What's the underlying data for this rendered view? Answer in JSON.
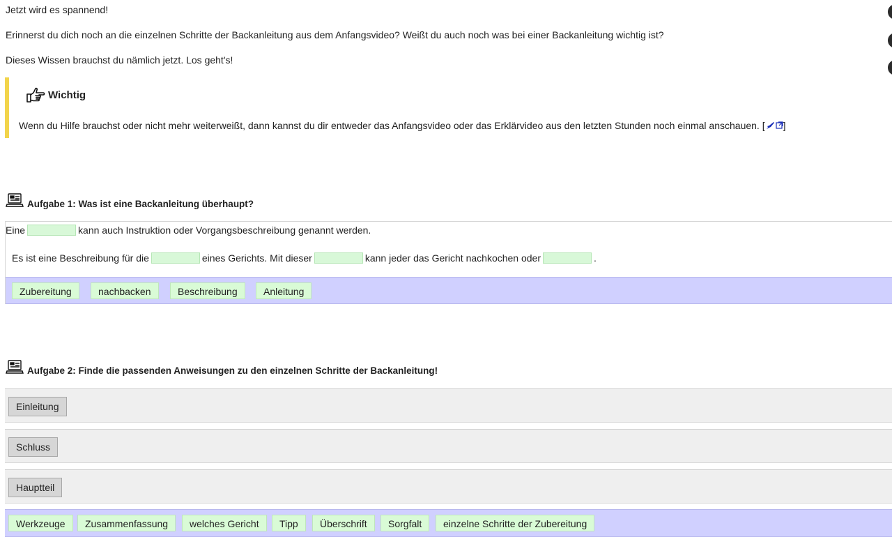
{
  "intro": {
    "line1": "Jetzt wird es spannend!",
    "line2": "Erinnerst du dich noch an die einzelnen Schritte der Backanleitung aus dem Anfangsvideo? Weißt du auch noch was bei einer Backanleitung wichtig ist?",
    "line3": "Dieses Wissen brauchst du nämlich jetzt. Los geht's!"
  },
  "notice": {
    "icon": "pointing-hand-icon",
    "title": "Wichtig",
    "text": "Wenn du Hilfe brauchst oder nicht mehr weiterweißt, dann kannst du dir entweder das Anfangsvideo oder das Erklärvideo aus den letzten Stunden noch einmal anschauen. [",
    "text_end": "]",
    "link_icon": "rocket-external-link-icon",
    "accent_color": "#f2d44b"
  },
  "task1": {
    "icon": "computer-icon",
    "title": "Aufgabe 1: Was ist eine Backanleitung überhaupt?",
    "sentence1": {
      "before": "Eine",
      "after": "kann auch Instruktion oder Vorgangsbeschreibung genannt werden."
    },
    "sentence2": {
      "part1": "Es ist eine Beschreibung für die",
      "part2": "eines Gerichts. Mit dieser",
      "part3": "kann jeder das Gericht nachkochen oder",
      "part4": "."
    },
    "words": [
      "Zubereitung",
      "nachbacken",
      "Beschreibung",
      "Anleitung"
    ],
    "wordbank_color": "#d0d0ff",
    "chip_color": "#d9fbd6"
  },
  "task2": {
    "icon": "computer-icon",
    "title": "Aufgabe 2: Finde die passenden Anweisungen zu den einzelnen Schritte der Backanleitung!",
    "zones": [
      "Einleitung",
      "Schluss",
      "Hauptteil"
    ],
    "words": [
      "Werkzeuge",
      "Zusammenfassung",
      "welches Gericht",
      "Tipp",
      "Überschrift",
      "Sorgfalt",
      "einzelne Schritte der Zubereitung"
    ]
  }
}
